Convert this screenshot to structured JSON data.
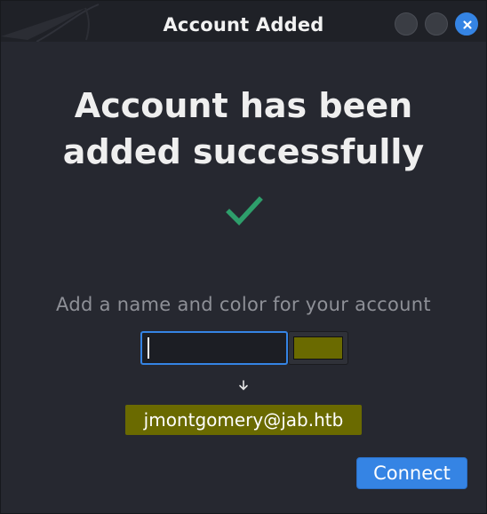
{
  "window": {
    "title": "Account Added"
  },
  "headline": {
    "line1": "Account has been",
    "line2": "added successfully"
  },
  "prompt": "Add a name and color for your account",
  "name_input": {
    "value": "",
    "placeholder": ""
  },
  "color_picker": {
    "selected_color": "#6a6a00"
  },
  "account": {
    "jid": "jmontgomery@jab.htb",
    "chip_color": "#6a6a00"
  },
  "buttons": {
    "connect": "Connect"
  },
  "colors": {
    "accent": "#3584e4",
    "success": "#2e9e6b"
  },
  "icons": {
    "close": "close-icon",
    "check": "checkmark-icon",
    "arrow": "arrow-down-icon"
  }
}
